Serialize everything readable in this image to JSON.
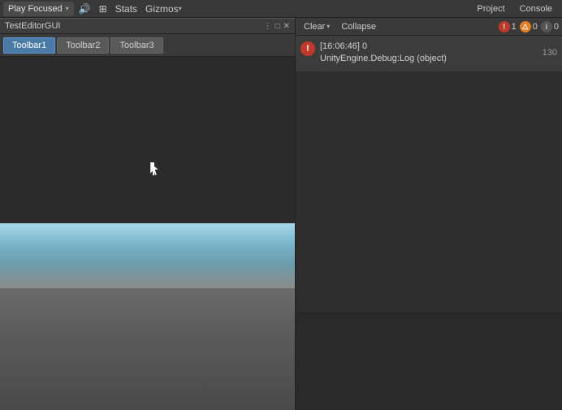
{
  "topbar": {
    "play_focused_label": "Play Focused",
    "dropdown_arrow": "▾",
    "stats_label": "Stats",
    "gizmos_label": "Gizmos",
    "project_label": "Project",
    "console_label": "Console"
  },
  "game_window": {
    "title": "TestEditorGUI",
    "toolbar": {
      "buttons": [
        {
          "label": "Toolbar1",
          "active": true
        },
        {
          "label": "Toolbar2",
          "active": false
        },
        {
          "label": "Toolbar3",
          "active": false
        }
      ]
    }
  },
  "console": {
    "clear_label": "Clear",
    "collapse_label": "Collapse",
    "badges": {
      "error_icon": "!",
      "error_count": "1",
      "warn_icon": "△",
      "warn_count": "0",
      "info_icon": "i",
      "info_count": "0"
    },
    "entries": [
      {
        "icon": "!",
        "icon_type": "error",
        "timestamp": "[16:06:46] 0",
        "message": "UnityEngine.Debug:Log (object)",
        "count": "130"
      }
    ]
  }
}
